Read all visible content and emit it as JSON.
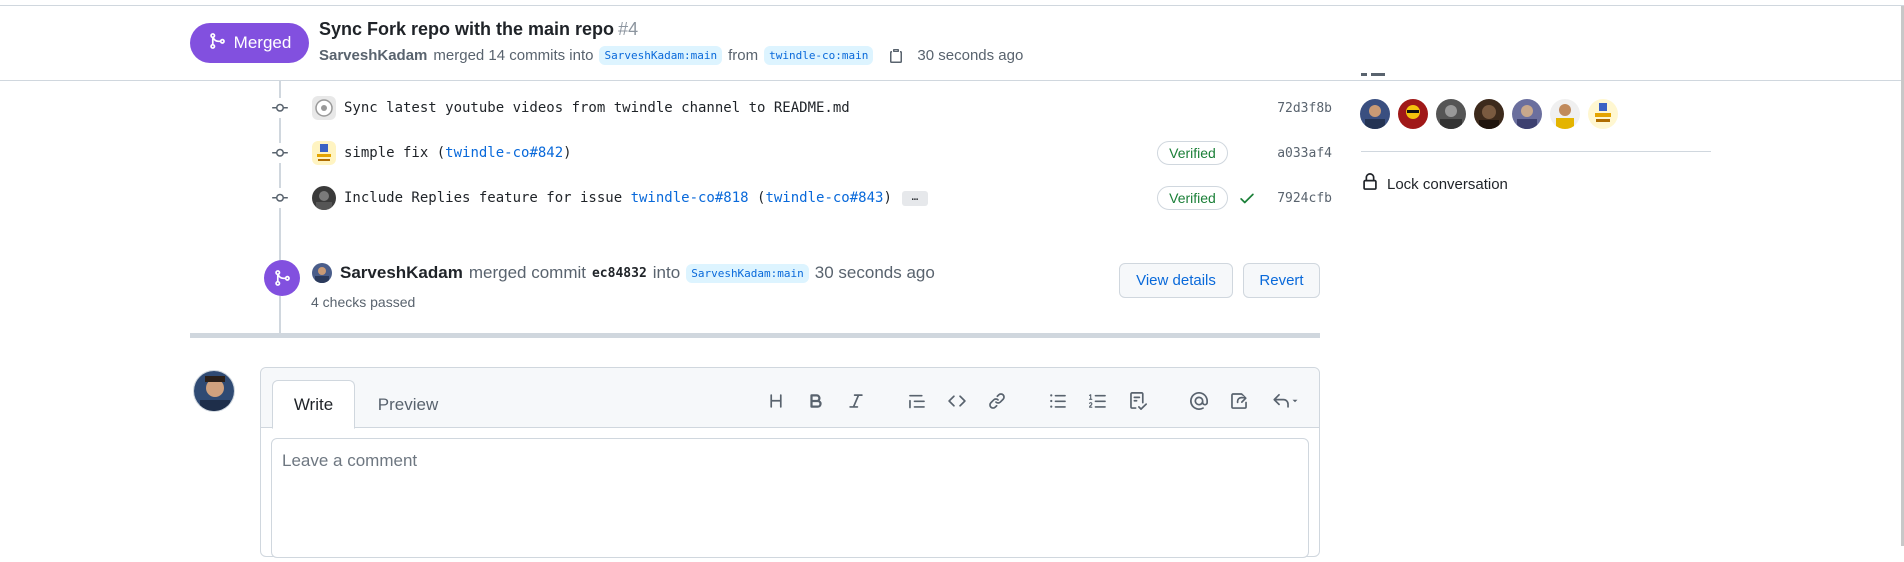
{
  "header": {
    "state": "Merged",
    "title": "Sync Fork repo with the main repo",
    "number": "#4",
    "author": "SarveshKadam",
    "merged_text": "merged 14 commits into",
    "base_branch": "SarveshKadam:main",
    "from_text": "from",
    "head_branch": "twindle-co:main",
    "time": "30 seconds ago"
  },
  "commits": [
    {
      "message": "Sync latest youtube videos from twindle channel to README.md",
      "verified": "",
      "sha": "72d3f8b"
    },
    {
      "message_prefix": "simple fix (",
      "link": "twindle-co#842",
      "message_suffix": ")",
      "verified": "Verified",
      "sha": "a033af4"
    },
    {
      "message_prefix": "Include Replies feature for issue ",
      "link1": "twindle-co#818",
      "mid": " (",
      "link2": "twindle-co#843",
      "message_suffix": ")",
      "ellipsis": "…",
      "verified": "Verified",
      "sha": "7924cfb"
    }
  ],
  "merge_event": {
    "author": "SarveshKadam",
    "text": "merged commit",
    "sha": "ec84832",
    "into": "into",
    "branch": "SarveshKadam:main",
    "time": "30 seconds ago",
    "checks": "4 checks passed",
    "view_details": "View details",
    "revert": "Revert"
  },
  "comment": {
    "tab_write": "Write",
    "tab_preview": "Preview",
    "placeholder": "Leave a comment",
    "toolbar": [
      "heading-icon",
      "bold-icon",
      "italic-icon",
      "quote-icon",
      "code-icon",
      "link-icon",
      "bullet-list-icon",
      "numbered-list-icon",
      "task-list-icon",
      "mention-icon",
      "reference-icon",
      "reply-icon"
    ]
  },
  "sidebar": {
    "lock_label": "Lock conversation"
  },
  "colors": {
    "merged": "#8250df",
    "link": "#0969da",
    "verified": "#1a7f37",
    "border": "#d0d7de"
  }
}
